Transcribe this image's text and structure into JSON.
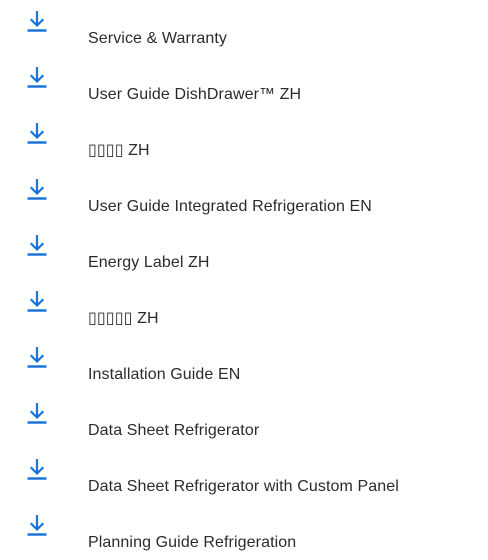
{
  "colors": {
    "icon": "#1a73d9",
    "text": "#2b2b2b",
    "background": "#ffffff"
  },
  "download_icon": "download-icon",
  "documents": [
    {
      "label": "Service & Warranty"
    },
    {
      "label": "User Guide DishDrawer™ ZH"
    },
    {
      "label": "▯▯▯▯ ZH"
    },
    {
      "label": "User Guide Integrated Refrigeration EN"
    },
    {
      "label": "Energy Label ZH"
    },
    {
      "label": "▯▯▯▯▯ ZH"
    },
    {
      "label": "Installation Guide EN"
    },
    {
      "label": "Data Sheet Refrigerator"
    },
    {
      "label": "Data Sheet Refrigerator with Custom Panel"
    },
    {
      "label": "Planning Guide Refrigeration"
    }
  ]
}
